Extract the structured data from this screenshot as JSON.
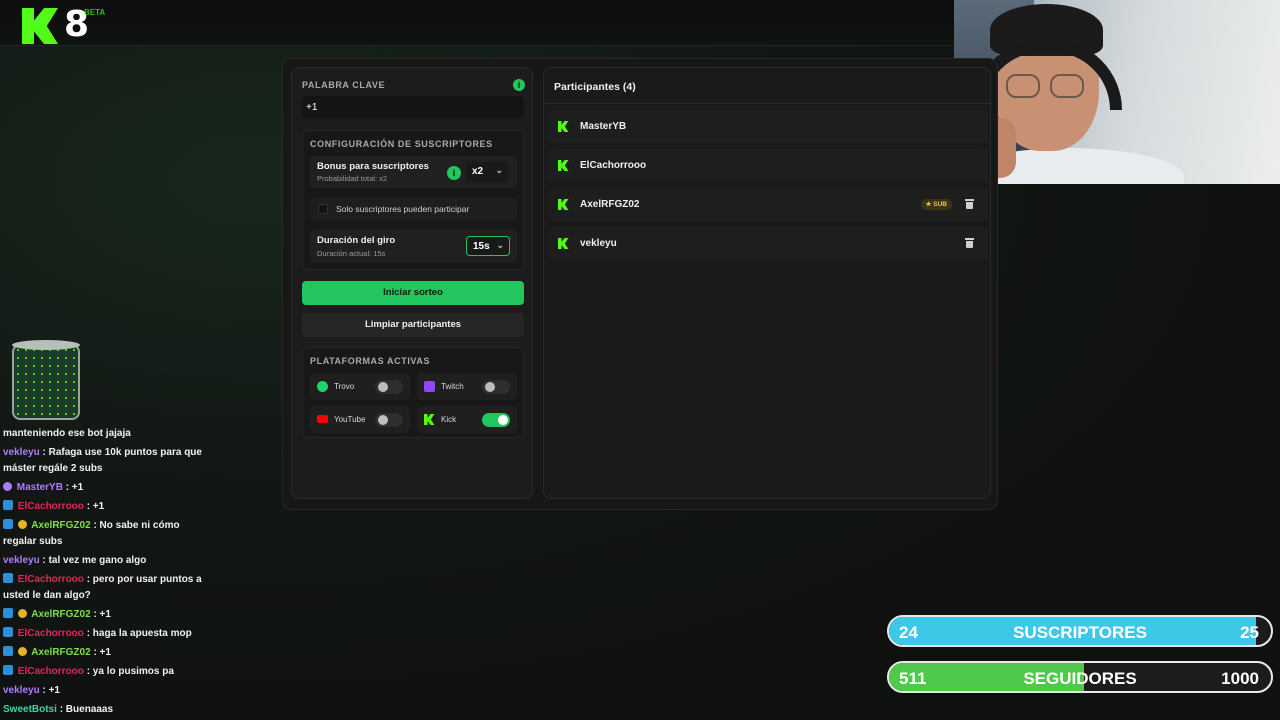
{
  "logo": {
    "badge": "8",
    "beta": "BETA"
  },
  "left_panel": {
    "keyword_label": "PALABRA CLAVE",
    "keyword_value": "+1",
    "info_icon": "i",
    "subs_config": {
      "title": "CONFIGURACIÓN DE SUSCRIPTORES",
      "bonus_title": "Bonus para suscriptores",
      "bonus_sub": "Probabilidad total: x2",
      "bonus_value": "x2",
      "only_subs_label": "Solo suscriptores pueden participar",
      "duration_title": "Duración del giro",
      "duration_sub": "Duración actual: 15s",
      "duration_value": "15s"
    },
    "start_button": "Iniciar sorteo",
    "clear_button": "Limpiar participantes",
    "platforms": {
      "title": "PLATAFORMAS ACTIVAS",
      "items": [
        {
          "name": "Trovo",
          "enabled": false,
          "color": "#19d66b"
        },
        {
          "name": "Twitch",
          "enabled": false,
          "color": "#9146ff"
        },
        {
          "name": "YouTube",
          "enabled": false,
          "color": "#ff0000"
        },
        {
          "name": "Kick",
          "enabled": true,
          "color": "#53fc18"
        }
      ]
    }
  },
  "participants": {
    "title": "Participantes (4)",
    "list": [
      {
        "name": "MasterYB",
        "sub": false
      },
      {
        "name": "ElCachorrooo",
        "sub": false
      },
      {
        "name": "AxelRFGZ02",
        "sub": true,
        "badge": "SUB"
      },
      {
        "name": "vekleyu",
        "sub": false
      }
    ]
  },
  "chat": [
    {
      "user": "",
      "text": "manteniendo ese bot jajaja"
    },
    {
      "user": "vekleyu",
      "text": ": Rafaga use 10k puntos para que máster regále 2 subs",
      "color": "#b07cff"
    },
    {
      "user": "MasterYB",
      "text": ": +1",
      "color": "#b07cff"
    },
    {
      "user": "ElCachorrooo",
      "text": ": +1",
      "color": "#e0285a"
    },
    {
      "user": "AxelRFGZ02",
      "text": ": No sabe ni cómo regalar subs",
      "color": "#7de04f"
    },
    {
      "user": "vekleyu",
      "text": ": tal vez me gano algo",
      "color": "#b07cff"
    },
    {
      "user": "ElCachorrooo",
      "text": ": pero por usar puntos a usted le dan algo?",
      "color": "#e0285a"
    },
    {
      "user": "AxelRFGZ02",
      "text": ": +1",
      "color": "#7de04f"
    },
    {
      "user": "ElCachorrooo",
      "text": ": haga la apuesta mop",
      "color": "#e0285a"
    },
    {
      "user": "AxelRFGZ02",
      "text": ": +1",
      "color": "#7de04f"
    },
    {
      "user": "ElCachorrooo",
      "text": ": ya lo pusimos pa",
      "color": "#e0285a"
    },
    {
      "user": "vekleyu",
      "text": ": +1",
      "color": "#b07cff"
    },
    {
      "user": "SweetBotsi",
      "text": ": Buenaaas",
      "color": "#3fd6a0"
    }
  ],
  "goals": [
    {
      "current": "24",
      "title": "SUSCRIPTORES",
      "target": "25",
      "progress": 0.96,
      "color": "#3ec8e8"
    },
    {
      "current": "511",
      "title": "SEGUIDORES",
      "target": "1000",
      "progress": 0.51,
      "color": "#4fc94a"
    }
  ]
}
